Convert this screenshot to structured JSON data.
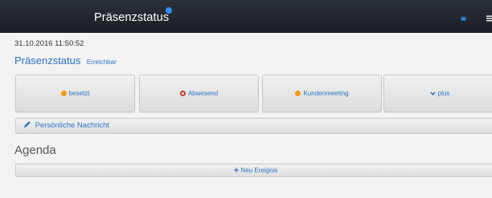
{
  "topbar": {
    "title": "Präsenzstatus",
    "icons": [
      "info-icon",
      "phone-icon",
      "menu-icon"
    ],
    "bg_color": "#1f242a",
    "accent_color": "#2f8ff2"
  },
  "status": {
    "timestamp": "31.10.2016 11:50:52",
    "title": "Präsenzstatus",
    "current": "Erreichbar",
    "text_color": "#2b73c4"
  },
  "buttons": [
    {
      "label": "besetzt",
      "icon": "orange-dot-icon",
      "color": "#f39c12"
    },
    {
      "label": "Abwesend",
      "icon": "red-close-circle-icon",
      "color": "#c9302c"
    },
    {
      "label": "Kundenmeeting",
      "icon": "orange-dot-icon",
      "color": "#f39c12"
    },
    {
      "label": "plus",
      "icon": "chevron-down-icon",
      "color": "#2b73c4"
    }
  ],
  "message": {
    "label": "Persönliche Nachricht",
    "icon": "pencil-icon"
  },
  "agenda": {
    "title": "Agenda",
    "new_event_label": "Neu Ereignis",
    "new_event_icon": "plus-icon"
  }
}
